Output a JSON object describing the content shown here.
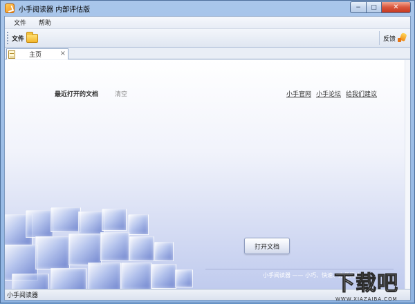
{
  "window": {
    "title": "小手阅读器 内部评估版",
    "controls": {
      "minimize": "−",
      "maximize": "□",
      "close": "✕"
    }
  },
  "menubar": {
    "items": [
      "文件",
      "帮助"
    ]
  },
  "toolbar": {
    "file_label": "文件",
    "feedback_label": "反馈"
  },
  "tabs": [
    {
      "label": "主页",
      "close": "×"
    }
  ],
  "content": {
    "recent_label": "最近打开的文档",
    "clear_label": "清空",
    "links": [
      "小手官网",
      "小手论坛",
      "给我们建议"
    ],
    "open_button": "打开文档",
    "footer": "小手阅读器 —— 小巧、快速、方便阅读"
  },
  "status": "小手阅读器",
  "watermark": {
    "main": "下载吧",
    "url": "WWW.XIAZAIBA.COM"
  },
  "colors": {
    "accent": "#5f76c8",
    "title_bar": "#a9c6ea",
    "close": "#c63a20"
  }
}
